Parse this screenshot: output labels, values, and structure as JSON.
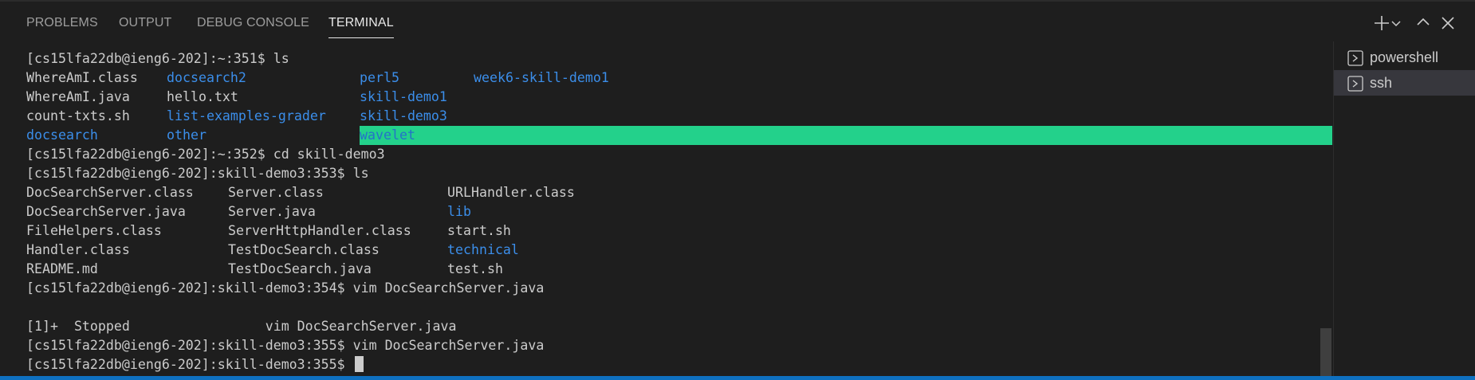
{
  "panel": {
    "tabs": [
      {
        "label": "PROBLEMS"
      },
      {
        "label": "OUTPUT"
      },
      {
        "label": "DEBUG CONSOLE"
      },
      {
        "label": "TERMINAL",
        "active": true
      }
    ],
    "actions": [
      "plus-icon",
      "chevron-down-icon",
      "chevron-up-icon",
      "close-icon"
    ]
  },
  "terminal": {
    "lines": {
      "l1": "[cs15lfa22db@ieng6-202]:~:351$ ls",
      "l2": [
        "WhereAmI.class",
        "docsearch2",
        "perl5",
        "week6-skill-demo1"
      ],
      "l3": [
        "WhereAmI.java",
        "hello.txt",
        "skill-demo1"
      ],
      "l4": [
        "count-txts.sh",
        "list-examples-grader",
        "skill-demo3"
      ],
      "l5": [
        "docsearch",
        "other",
        "wavelet"
      ],
      "l6": "[cs15lfa22db@ieng6-202]:~:352$ cd skill-demo3",
      "l7": "[cs15lfa22db@ieng6-202]:skill-demo3:353$ ls",
      "l8": [
        "DocSearchServer.class",
        "Server.class",
        "URLHandler.class"
      ],
      "l9": [
        "DocSearchServer.java",
        "Server.java",
        "lib"
      ],
      "l10": [
        "FileHelpers.class",
        "ServerHttpHandler.class",
        "start.sh"
      ],
      "l11": [
        "Handler.class",
        "TestDocSearch.class",
        "technical"
      ],
      "l12": [
        "README.md",
        "TestDocSearch.java",
        "test.sh"
      ],
      "l13": "[cs15lfa22db@ieng6-202]:skill-demo3:354$ vim DocSearchServer.java",
      "l14": "",
      "l15": "[1]+  Stopped                 vim DocSearchServer.java",
      "l16": "[cs15lfa22db@ieng6-202]:skill-demo3:355$ vim DocSearchServer.java",
      "l17": "[cs15lfa22db@ieng6-202]:skill-demo3:355$ "
    }
  },
  "terminal_list": [
    {
      "label": "powershell",
      "icon": "terminal-icon"
    },
    {
      "label": "ssh",
      "icon": "terminal-icon",
      "selected": true
    }
  ],
  "colors": {
    "background": "#1e1e1e",
    "text": "#cccccc",
    "directory": "#3b8eea",
    "highlight_bg": "#23d18b",
    "highlight_fg": "#2472c8",
    "status_bar": "#0e70c0"
  }
}
